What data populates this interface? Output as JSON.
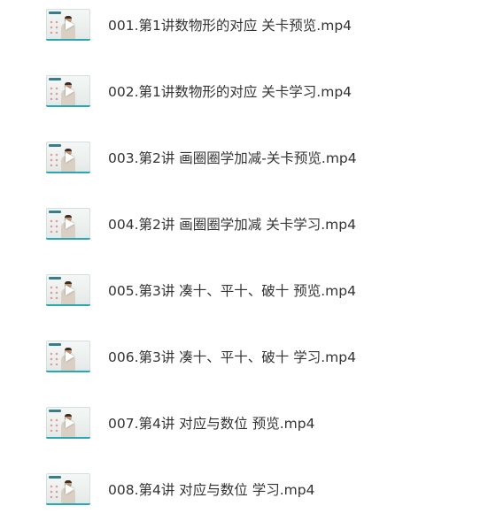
{
  "files": [
    {
      "name": "001.第1讲数物形的对应 关卡预览.mp4",
      "icon": "video-thumbnail-icon"
    },
    {
      "name": "002.第1讲数物形的对应 关卡学习.mp4",
      "icon": "video-thumbnail-icon"
    },
    {
      "name": "003.第2讲 画圈圈学加减-关卡预览.mp4",
      "icon": "video-thumbnail-icon"
    },
    {
      "name": "004.第2讲 画圈圈学加减 关卡学习.mp4",
      "icon": "video-thumbnail-icon"
    },
    {
      "name": "005.第3讲 凑十、平十、破十 预览.mp4",
      "icon": "video-thumbnail-icon"
    },
    {
      "name": "006.第3讲 凑十、平十、破十 学习.mp4",
      "icon": "video-thumbnail-icon"
    },
    {
      "name": "007.第4讲 对应与数位 预览.mp4",
      "icon": "video-thumbnail-icon"
    },
    {
      "name": "008.第4讲 对应与数位 学习.mp4",
      "icon": "video-thumbnail-icon"
    }
  ],
  "colors": {
    "text": "#333333",
    "thumb_accent": "#2aa7b3"
  }
}
